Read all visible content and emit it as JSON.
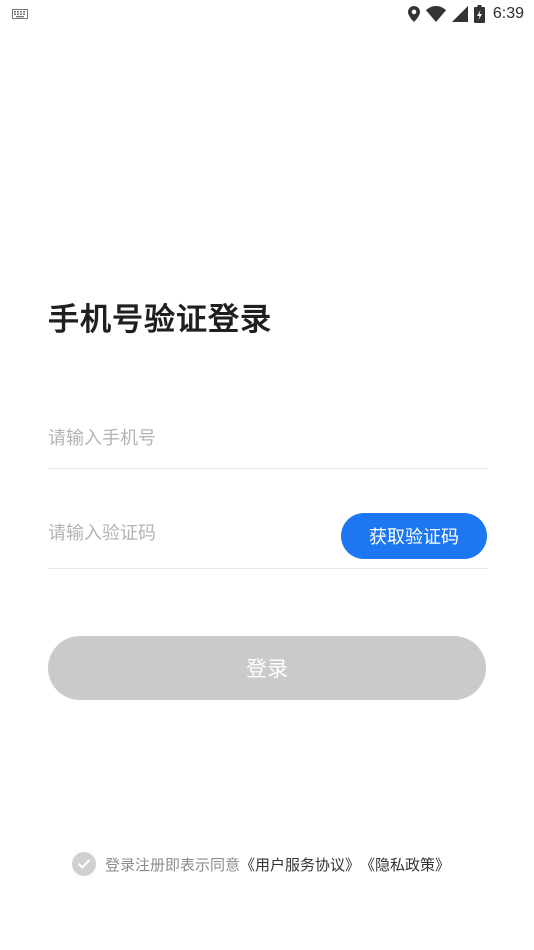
{
  "status_bar": {
    "time": "6:39",
    "icons": [
      "keyboard-icon",
      "location-icon",
      "wifi-icon",
      "signal-icon",
      "battery-icon"
    ]
  },
  "login": {
    "title": "手机号验证登录",
    "phone_placeholder": "请输入手机号",
    "code_placeholder": "请输入验证码",
    "get_code_label": "获取验证码",
    "login_label": "登录"
  },
  "agreement": {
    "text": "登录注册即表示同意",
    "user_agreement": "《用户服务协议》",
    "privacy_policy": "《隐私政策》"
  },
  "colors": {
    "accent": "#1e77f2",
    "login_disabled": "#cacaca",
    "placeholder": "#b3b3b3",
    "divider": "#e6e6e6"
  }
}
